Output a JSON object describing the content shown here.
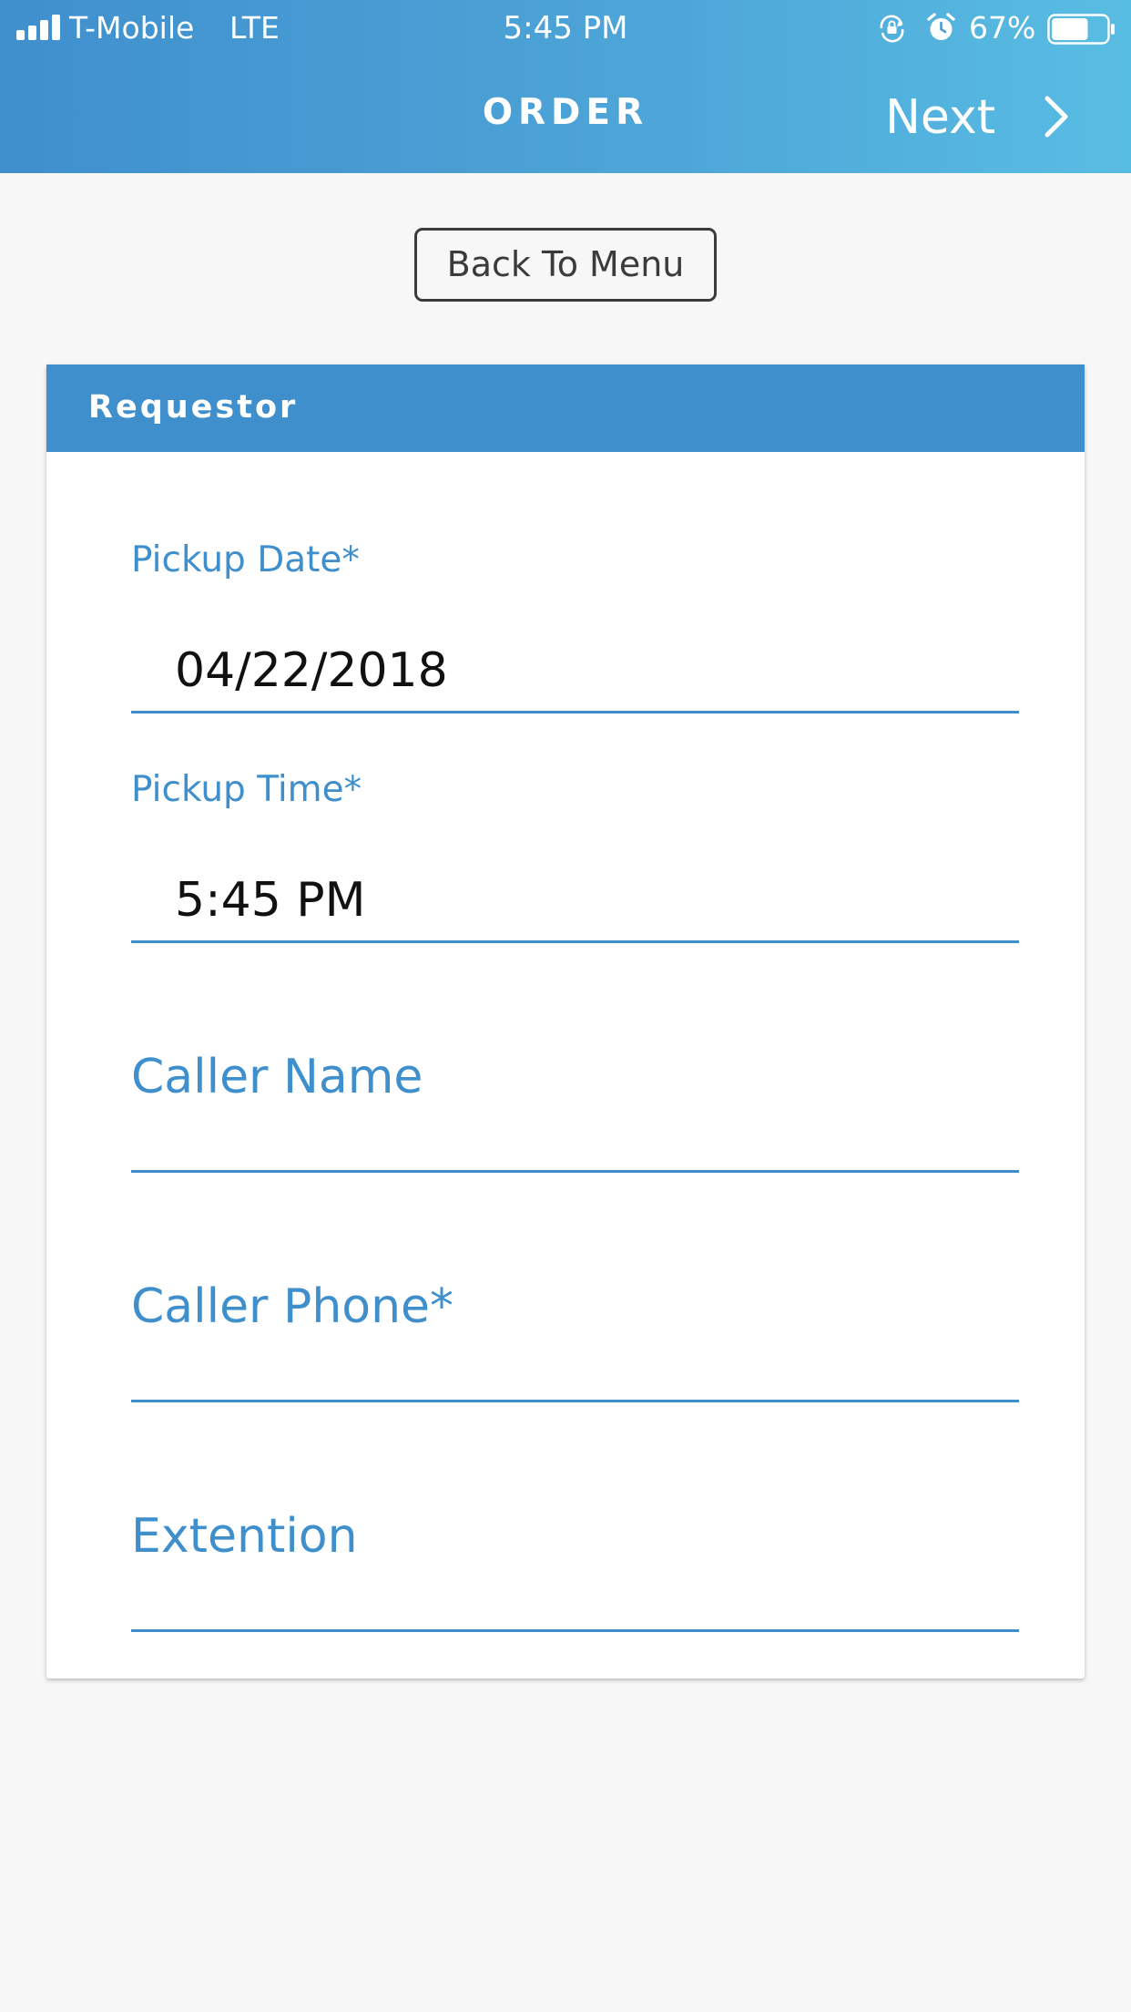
{
  "status_bar": {
    "carrier": "T-Mobile",
    "network": "LTE",
    "time": "5:45 PM",
    "battery_percent": "67%",
    "battery_level": 0.67,
    "icons": [
      "signal-icon",
      "rotation-lock-icon",
      "alarm-icon",
      "battery-icon"
    ]
  },
  "nav": {
    "title": "ORDER",
    "next_label": "Next",
    "next_icon": "chevron-right-icon"
  },
  "back_button": {
    "label": "Back To Menu"
  },
  "card": {
    "title": "Requestor",
    "fields": [
      {
        "label": "Pickup Date*",
        "value": "04/22/2018"
      },
      {
        "label": "Pickup Time*",
        "value": "5:45 PM"
      },
      {
        "placeholder": "Caller Name",
        "value": ""
      },
      {
        "placeholder": "Caller Phone*",
        "value": ""
      },
      {
        "placeholder": "Extention",
        "value": ""
      }
    ]
  },
  "colors": {
    "primary": "#3f8fcd",
    "header_gradient_end": "#58bde3",
    "background": "#f7f7f7",
    "card": "#ffffff",
    "text_dark": "#111111",
    "button_border": "#3b3b3b"
  }
}
